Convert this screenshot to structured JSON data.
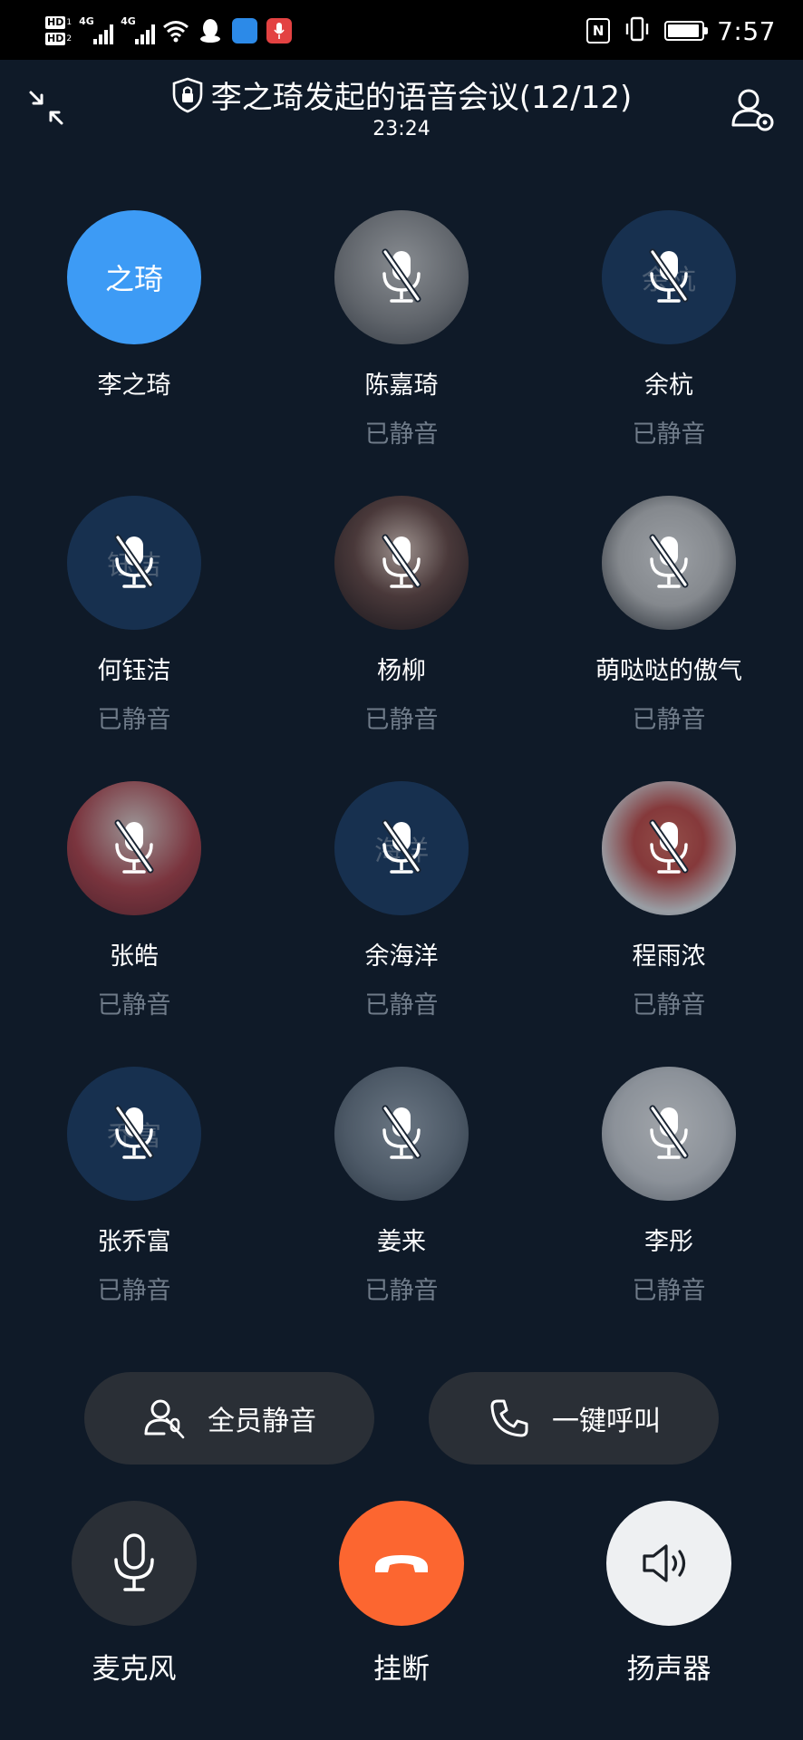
{
  "status_bar": {
    "sim1_badge": "HD",
    "sim1_index": "1",
    "sim2_badge": "HD",
    "sim2_index": "2",
    "net1": "4G",
    "net2": "4G",
    "nfc": "N",
    "battery_level": 0.95,
    "time": "7:57"
  },
  "header": {
    "title": "李之琦发起的语音会议(12/12)",
    "timer": "23:24"
  },
  "participants": [
    {
      "name": "李之琦",
      "status": "",
      "initials": "之琦",
      "avatar": "solid-blue",
      "muted": false
    },
    {
      "name": "陈嘉琦",
      "status": "已静音",
      "initials": "",
      "avatar": "photo-gray",
      "muted": true
    },
    {
      "name": "余杭",
      "status": "已静音",
      "initials": "余杭",
      "avatar": "solid-navy",
      "muted": true
    },
    {
      "name": "何钰洁",
      "status": "已静音",
      "initials": "钰洁",
      "avatar": "solid-navy",
      "muted": true
    },
    {
      "name": "杨柳",
      "status": "已静音",
      "initials": "",
      "avatar": "photo-portrait",
      "muted": true
    },
    {
      "name": "萌哒哒的傲气",
      "status": "已静音",
      "initials": "",
      "avatar": "photo-cartoon",
      "muted": true
    },
    {
      "name": "张皓",
      "status": "已静音",
      "initials": "",
      "avatar": "photo-red",
      "muted": true
    },
    {
      "name": "余海洋",
      "status": "已静音",
      "initials": "海洋",
      "avatar": "solid-navy",
      "muted": true
    },
    {
      "name": "程雨浓",
      "status": "已静音",
      "initials": "",
      "avatar": "photo-bird",
      "muted": true
    },
    {
      "name": "张乔富",
      "status": "已静音",
      "initials": "乔富",
      "avatar": "solid-navy",
      "muted": true
    },
    {
      "name": "姜来",
      "status": "已静音",
      "initials": "",
      "avatar": "photo-mist",
      "muted": true
    },
    {
      "name": "李彤",
      "status": "已静音",
      "initials": "",
      "avatar": "photo-sketch",
      "muted": true
    }
  ],
  "actions": {
    "mute_all_label": "全员静音",
    "call_all_label": "一键呼叫"
  },
  "controls": {
    "mic_label": "麦克风",
    "hangup_label": "挂断",
    "speaker_label": "扬声器"
  },
  "colors": {
    "background": "#0f1a28",
    "active_avatar": "#3d9bf5",
    "muted_avatar": "#1d3d64",
    "hangup": "#fc6630",
    "pill_bg": "#2a2f36",
    "speaker_active": "#eef0f2",
    "muted_text": "#6f7b89"
  }
}
